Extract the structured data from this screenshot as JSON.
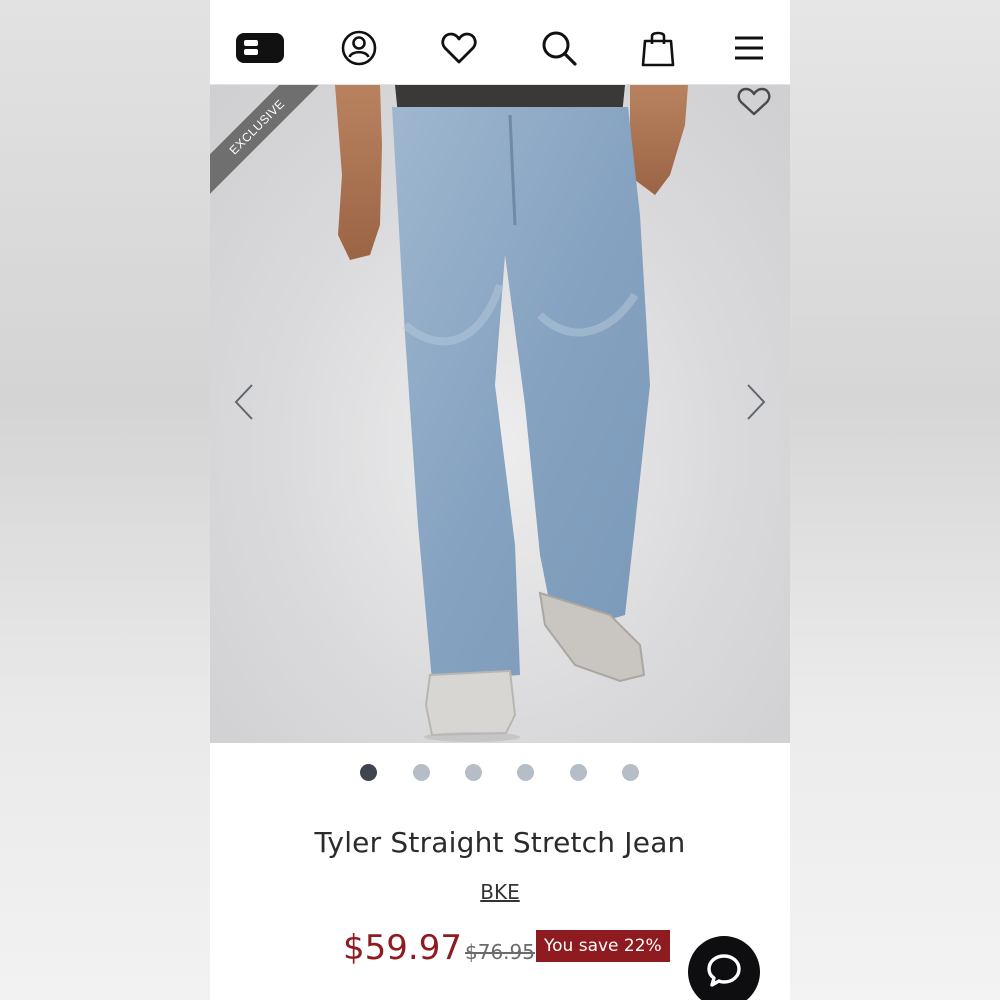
{
  "nav": {
    "icons": [
      "brand-logo-icon",
      "account-icon",
      "wishlist-icon",
      "search-icon",
      "shopping-bag-icon",
      "menu-icon"
    ]
  },
  "hero": {
    "badge": "EXCLUSIVE",
    "image_description_icon": "product-photo",
    "slide_count": 6,
    "active_slide": 1
  },
  "product": {
    "title": "Tyler Straight Stretch Jean",
    "brand": "BKE",
    "sale_price": "$59.97",
    "original_price": "$76.95",
    "savings": "You save 22%"
  },
  "colors": {
    "price": "#8e1b1f",
    "dot_active": "#3f4650",
    "dot_inactive": "#b5bec7",
    "badge": "#6f6f6f"
  }
}
